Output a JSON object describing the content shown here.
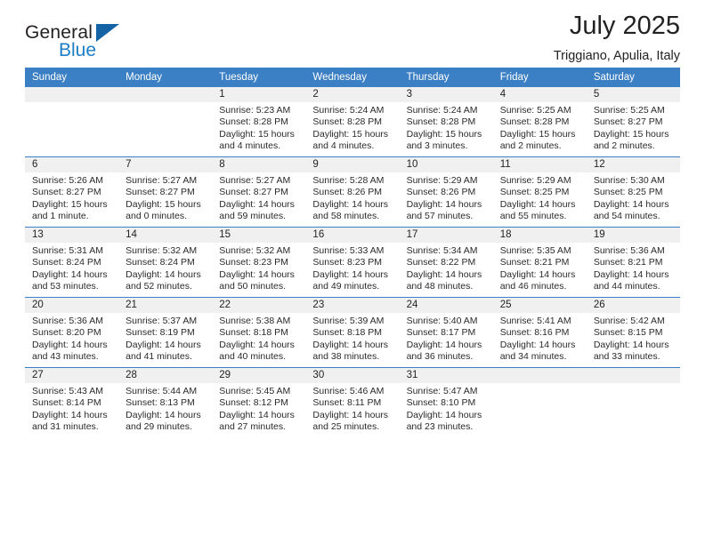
{
  "brand": {
    "name_top": "General",
    "name_bottom": "Blue",
    "triangle_icon": "blue-triangle-icon",
    "color_dark": "#231f20",
    "color_blue": "#1f7dc4"
  },
  "header": {
    "title": "July 2025",
    "subtitle": "Triggiano, Apulia, Italy"
  },
  "theme": {
    "header_blue": "#3b7fc4",
    "date_band_gray": "#f0f0f0",
    "text": "#222222"
  },
  "columns": [
    "Sunday",
    "Monday",
    "Tuesday",
    "Wednesday",
    "Thursday",
    "Friday",
    "Saturday"
  ],
  "labels": {
    "sunrise_prefix": "Sunrise:",
    "sunset_prefix": "Sunset:",
    "daylight_prefix": "Daylight:"
  },
  "weeks": [
    [
      {
        "day": "",
        "sunrise": "",
        "sunset": "",
        "daylight_1": "",
        "daylight_2": ""
      },
      {
        "day": "",
        "sunrise": "",
        "sunset": "",
        "daylight_1": "",
        "daylight_2": ""
      },
      {
        "day": "1",
        "sunrise": "Sunrise: 5:23 AM",
        "sunset": "Sunset: 8:28 PM",
        "daylight_1": "Daylight: 15 hours",
        "daylight_2": "and 4 minutes."
      },
      {
        "day": "2",
        "sunrise": "Sunrise: 5:24 AM",
        "sunset": "Sunset: 8:28 PM",
        "daylight_1": "Daylight: 15 hours",
        "daylight_2": "and 4 minutes."
      },
      {
        "day": "3",
        "sunrise": "Sunrise: 5:24 AM",
        "sunset": "Sunset: 8:28 PM",
        "daylight_1": "Daylight: 15 hours",
        "daylight_2": "and 3 minutes."
      },
      {
        "day": "4",
        "sunrise": "Sunrise: 5:25 AM",
        "sunset": "Sunset: 8:28 PM",
        "daylight_1": "Daylight: 15 hours",
        "daylight_2": "and 2 minutes."
      },
      {
        "day": "5",
        "sunrise": "Sunrise: 5:25 AM",
        "sunset": "Sunset: 8:27 PM",
        "daylight_1": "Daylight: 15 hours",
        "daylight_2": "and 2 minutes."
      }
    ],
    [
      {
        "day": "6",
        "sunrise": "Sunrise: 5:26 AM",
        "sunset": "Sunset: 8:27 PM",
        "daylight_1": "Daylight: 15 hours",
        "daylight_2": "and 1 minute."
      },
      {
        "day": "7",
        "sunrise": "Sunrise: 5:27 AM",
        "sunset": "Sunset: 8:27 PM",
        "daylight_1": "Daylight: 15 hours",
        "daylight_2": "and 0 minutes."
      },
      {
        "day": "8",
        "sunrise": "Sunrise: 5:27 AM",
        "sunset": "Sunset: 8:27 PM",
        "daylight_1": "Daylight: 14 hours",
        "daylight_2": "and 59 minutes."
      },
      {
        "day": "9",
        "sunrise": "Sunrise: 5:28 AM",
        "sunset": "Sunset: 8:26 PM",
        "daylight_1": "Daylight: 14 hours",
        "daylight_2": "and 58 minutes."
      },
      {
        "day": "10",
        "sunrise": "Sunrise: 5:29 AM",
        "sunset": "Sunset: 8:26 PM",
        "daylight_1": "Daylight: 14 hours",
        "daylight_2": "and 57 minutes."
      },
      {
        "day": "11",
        "sunrise": "Sunrise: 5:29 AM",
        "sunset": "Sunset: 8:25 PM",
        "daylight_1": "Daylight: 14 hours",
        "daylight_2": "and 55 minutes."
      },
      {
        "day": "12",
        "sunrise": "Sunrise: 5:30 AM",
        "sunset": "Sunset: 8:25 PM",
        "daylight_1": "Daylight: 14 hours",
        "daylight_2": "and 54 minutes."
      }
    ],
    [
      {
        "day": "13",
        "sunrise": "Sunrise: 5:31 AM",
        "sunset": "Sunset: 8:24 PM",
        "daylight_1": "Daylight: 14 hours",
        "daylight_2": "and 53 minutes."
      },
      {
        "day": "14",
        "sunrise": "Sunrise: 5:32 AM",
        "sunset": "Sunset: 8:24 PM",
        "daylight_1": "Daylight: 14 hours",
        "daylight_2": "and 52 minutes."
      },
      {
        "day": "15",
        "sunrise": "Sunrise: 5:32 AM",
        "sunset": "Sunset: 8:23 PM",
        "daylight_1": "Daylight: 14 hours",
        "daylight_2": "and 50 minutes."
      },
      {
        "day": "16",
        "sunrise": "Sunrise: 5:33 AM",
        "sunset": "Sunset: 8:23 PM",
        "daylight_1": "Daylight: 14 hours",
        "daylight_2": "and 49 minutes."
      },
      {
        "day": "17",
        "sunrise": "Sunrise: 5:34 AM",
        "sunset": "Sunset: 8:22 PM",
        "daylight_1": "Daylight: 14 hours",
        "daylight_2": "and 48 minutes."
      },
      {
        "day": "18",
        "sunrise": "Sunrise: 5:35 AM",
        "sunset": "Sunset: 8:21 PM",
        "daylight_1": "Daylight: 14 hours",
        "daylight_2": "and 46 minutes."
      },
      {
        "day": "19",
        "sunrise": "Sunrise: 5:36 AM",
        "sunset": "Sunset: 8:21 PM",
        "daylight_1": "Daylight: 14 hours",
        "daylight_2": "and 44 minutes."
      }
    ],
    [
      {
        "day": "20",
        "sunrise": "Sunrise: 5:36 AM",
        "sunset": "Sunset: 8:20 PM",
        "daylight_1": "Daylight: 14 hours",
        "daylight_2": "and 43 minutes."
      },
      {
        "day": "21",
        "sunrise": "Sunrise: 5:37 AM",
        "sunset": "Sunset: 8:19 PM",
        "daylight_1": "Daylight: 14 hours",
        "daylight_2": "and 41 minutes."
      },
      {
        "day": "22",
        "sunrise": "Sunrise: 5:38 AM",
        "sunset": "Sunset: 8:18 PM",
        "daylight_1": "Daylight: 14 hours",
        "daylight_2": "and 40 minutes."
      },
      {
        "day": "23",
        "sunrise": "Sunrise: 5:39 AM",
        "sunset": "Sunset: 8:18 PM",
        "daylight_1": "Daylight: 14 hours",
        "daylight_2": "and 38 minutes."
      },
      {
        "day": "24",
        "sunrise": "Sunrise: 5:40 AM",
        "sunset": "Sunset: 8:17 PM",
        "daylight_1": "Daylight: 14 hours",
        "daylight_2": "and 36 minutes."
      },
      {
        "day": "25",
        "sunrise": "Sunrise: 5:41 AM",
        "sunset": "Sunset: 8:16 PM",
        "daylight_1": "Daylight: 14 hours",
        "daylight_2": "and 34 minutes."
      },
      {
        "day": "26",
        "sunrise": "Sunrise: 5:42 AM",
        "sunset": "Sunset: 8:15 PM",
        "daylight_1": "Daylight: 14 hours",
        "daylight_2": "and 33 minutes."
      }
    ],
    [
      {
        "day": "27",
        "sunrise": "Sunrise: 5:43 AM",
        "sunset": "Sunset: 8:14 PM",
        "daylight_1": "Daylight: 14 hours",
        "daylight_2": "and 31 minutes."
      },
      {
        "day": "28",
        "sunrise": "Sunrise: 5:44 AM",
        "sunset": "Sunset: 8:13 PM",
        "daylight_1": "Daylight: 14 hours",
        "daylight_2": "and 29 minutes."
      },
      {
        "day": "29",
        "sunrise": "Sunrise: 5:45 AM",
        "sunset": "Sunset: 8:12 PM",
        "daylight_1": "Daylight: 14 hours",
        "daylight_2": "and 27 minutes."
      },
      {
        "day": "30",
        "sunrise": "Sunrise: 5:46 AM",
        "sunset": "Sunset: 8:11 PM",
        "daylight_1": "Daylight: 14 hours",
        "daylight_2": "and 25 minutes."
      },
      {
        "day": "31",
        "sunrise": "Sunrise: 5:47 AM",
        "sunset": "Sunset: 8:10 PM",
        "daylight_1": "Daylight: 14 hours",
        "daylight_2": "and 23 minutes."
      },
      {
        "day": "",
        "sunrise": "",
        "sunset": "",
        "daylight_1": "",
        "daylight_2": ""
      },
      {
        "day": "",
        "sunrise": "",
        "sunset": "",
        "daylight_1": "",
        "daylight_2": ""
      }
    ]
  ]
}
